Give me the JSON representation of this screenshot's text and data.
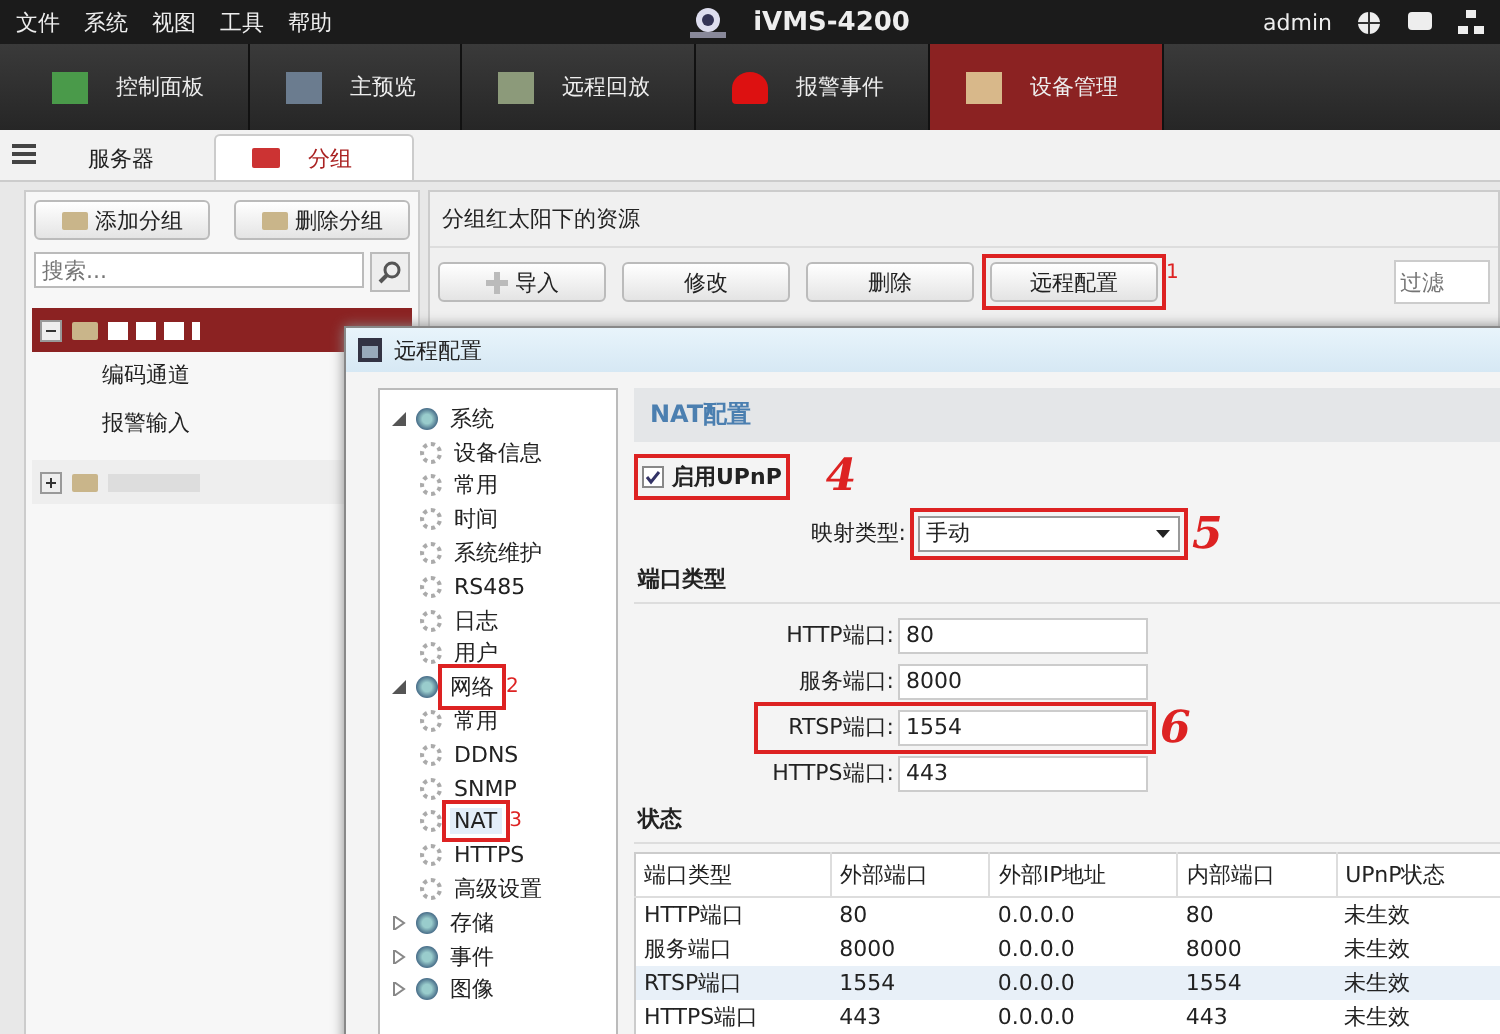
{
  "menu": [
    "文件",
    "系统",
    "视图",
    "工具",
    "帮助"
  ],
  "app_title": "iVMS-4200",
  "user": "admin",
  "nav_tabs": [
    {
      "label": "控制面板",
      "selected": false
    },
    {
      "label": "主预览",
      "selected": false
    },
    {
      "label": "远程回放",
      "selected": false
    },
    {
      "label": "报警事件",
      "selected": false
    },
    {
      "label": "设备管理",
      "selected": true
    }
  ],
  "sub_tabs": [
    {
      "label": "服务器",
      "selected": false
    },
    {
      "label": "分组",
      "selected": true
    }
  ],
  "group_buttons": [
    "添加分组",
    "删除分组"
  ],
  "group_search": {
    "placeholder": "搜索..."
  },
  "group_tree": [
    {
      "selected": true,
      "expanded": true,
      "children": [
        {
          "label": "编码通道"
        },
        {
          "label": "报警输入"
        }
      ]
    },
    {
      "selected": false,
      "expanded": false
    }
  ],
  "resources": {
    "title": "分组红太阳下的资源",
    "filter": {
      "placeholder": "过滤"
    },
    "toolbar": [
      {
        "label": "导入",
        "kind": "add"
      },
      {
        "label": "修改",
        "kind": "plain"
      },
      {
        "label": "删除",
        "kind": "plain"
      },
      {
        "label": "远程配置",
        "kind": "plain",
        "annotation": {
          "text": "1",
          "kind": "printed"
        }
      }
    ]
  },
  "dialog": {
    "title": "远程配置",
    "tree": [
      {
        "label": "系统",
        "expanded": true,
        "children": [
          {
            "label": "设备信息",
            "selected": false
          },
          {
            "label": "常用",
            "selected": false
          },
          {
            "label": "时间",
            "selected": false
          },
          {
            "label": "系统维护",
            "selected": false
          },
          {
            "label": "RS485",
            "selected": false
          },
          {
            "label": "日志",
            "selected": false
          },
          {
            "label": "用户",
            "selected": false
          }
        ]
      },
      {
        "label": "网络",
        "expanded": true,
        "annotation": {
          "text": "2",
          "kind": "printed"
        },
        "children": [
          {
            "label": "常用",
            "selected": false
          },
          {
            "label": "DDNS",
            "selected": false
          },
          {
            "label": "SNMP",
            "selected": false
          },
          {
            "label": "NAT",
            "selected": true,
            "annotation": {
              "text": "3",
              "kind": "printed"
            }
          },
          {
            "label": "HTTPS",
            "selected": false
          },
          {
            "label": "高级设置",
            "selected": false
          }
        ]
      },
      {
        "label": "存储",
        "expanded": false
      },
      {
        "label": "事件",
        "expanded": false
      },
      {
        "label": "图像",
        "expanded": false
      }
    ],
    "heading": "NAT配置",
    "upnp": {
      "label": "启用UPnP",
      "checked": true,
      "annotation": {
        "text": "4",
        "kind": "handwritten"
      }
    },
    "mapping": {
      "label": "映射类型:",
      "value": "手动",
      "annotation": {
        "text": "5",
        "kind": "handwritten"
      }
    },
    "ports_heading": "端口类型",
    "ports": [
      {
        "label": "HTTP端口:",
        "value": "80"
      },
      {
        "label": "服务端口:",
        "value": "8000"
      },
      {
        "label": "RTSP端口:",
        "value": "1554",
        "annotation": {
          "text": "6",
          "kind": "handwritten"
        }
      },
      {
        "label": "HTTPS端口:",
        "value": "443"
      }
    ],
    "status_heading": "状态",
    "status_table": {
      "columns": [
        "端口类型",
        "外部端口",
        "外部IP地址",
        "内部端口",
        "UPnP状态"
      ],
      "rows": [
        {
          "cells": [
            "HTTP端口",
            "80",
            "0.0.0.0",
            "80",
            "未生效"
          ],
          "selected": false
        },
        {
          "cells": [
            "服务端口",
            "8000",
            "0.0.0.0",
            "8000",
            "未生效"
          ],
          "selected": false
        },
        {
          "cells": [
            "RTSP端口",
            "1554",
            "0.0.0.0",
            "1554",
            "未生效"
          ],
          "selected": true
        },
        {
          "cells": [
            "HTTPS端口",
            "443",
            "0.0.0.0",
            "443",
            "未生效"
          ],
          "selected": false
        }
      ]
    }
  }
}
